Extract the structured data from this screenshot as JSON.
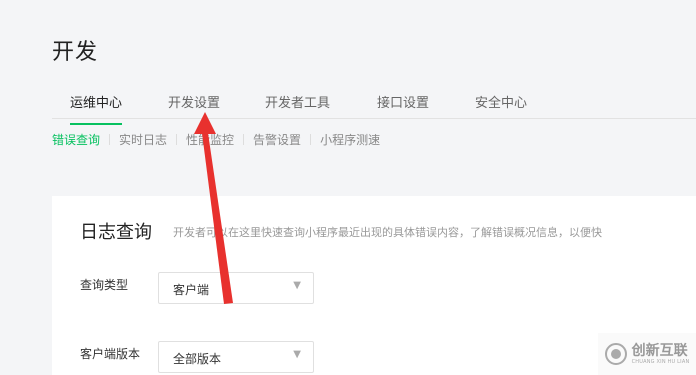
{
  "page": {
    "title": "开发"
  },
  "main_tabs": [
    {
      "label": "运维中心",
      "active": true
    },
    {
      "label": "开发设置",
      "active": false
    },
    {
      "label": "开发者工具",
      "active": false
    },
    {
      "label": "接口设置",
      "active": false
    },
    {
      "label": "安全中心",
      "active": false
    }
  ],
  "sub_tabs": [
    {
      "label": "错误查询",
      "active": true
    },
    {
      "label": "实时日志",
      "active": false
    },
    {
      "label": "性能监控",
      "active": false
    },
    {
      "label": "告警设置",
      "active": false
    },
    {
      "label": "小程序测速",
      "active": false
    }
  ],
  "log_query": {
    "title": "日志查询",
    "description": "开发者可以在这里快速查询小程序最近出现的具体错误内容，了解错误概况信息，以便快",
    "query_type": {
      "label": "查询类型",
      "value": "客户端"
    },
    "client_version": {
      "label": "客户端版本",
      "value": "全部版本"
    }
  },
  "annotation": {
    "color": "#e8312e"
  },
  "watermark": {
    "main": "创新互联",
    "sub": "CHUANG XIN HU LIAN"
  },
  "colors": {
    "accent": "#07c160",
    "background": "#f4f5f7"
  }
}
